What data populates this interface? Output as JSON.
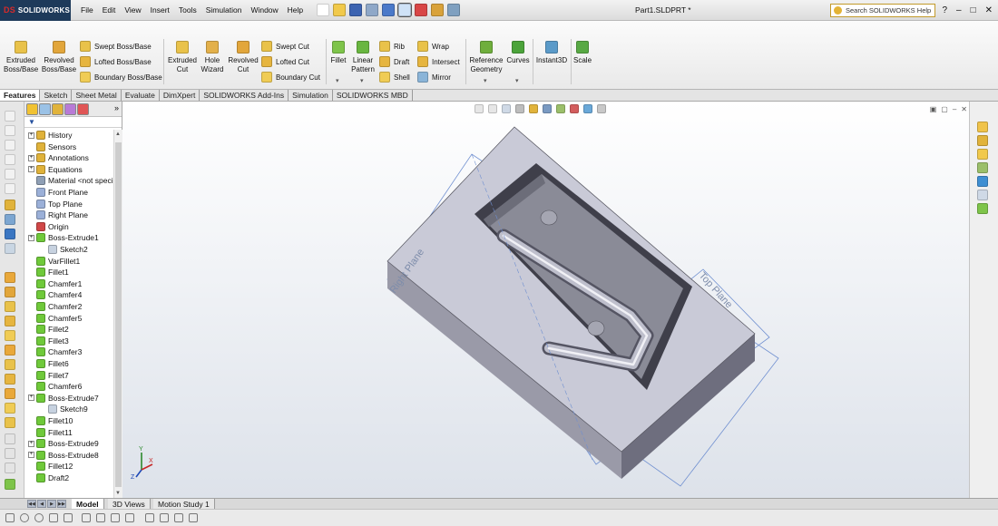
{
  "app": {
    "brand": "SOLIDWORKS",
    "brand_mark": "DS",
    "document_title": "Part1.SLDPRT *",
    "search_placeholder": "Search SOLIDWORKS Help",
    "window_controls": [
      "?",
      "–",
      "□",
      "✕"
    ]
  },
  "menu": [
    "File",
    "Edit",
    "View",
    "Insert",
    "Tools",
    "Simulation",
    "Window",
    "Help"
  ],
  "ribbon": {
    "extruded_boss": [
      "Extruded",
      "Boss/Base"
    ],
    "revolved_boss": [
      "Revolved",
      "Boss/Base"
    ],
    "swept_boss": "Swept Boss/Base",
    "lofted_boss": "Lofted Boss/Base",
    "boundary_boss": "Boundary Boss/Base",
    "extruded_cut": [
      "Extruded",
      "Cut"
    ],
    "hole_wizard": [
      "Hole",
      "Wizard"
    ],
    "revolved_cut": [
      "Revolved",
      "Cut"
    ],
    "swept_cut": "Swept Cut",
    "lofted_cut": "Lofted Cut",
    "boundary_cut": "Boundary Cut",
    "fillet": "Fillet",
    "linear_pattern": [
      "Linear",
      "Pattern"
    ],
    "rib": "Rib",
    "draft": "Draft",
    "shell": "Shell",
    "wrap": "Wrap",
    "intersect": "Intersect",
    "mirror": "Mirror",
    "reference_geometry": [
      "Reference",
      "Geometry"
    ],
    "curves": "Curves",
    "instant3d": "Instant3D",
    "scale": "Scale"
  },
  "tabs": [
    {
      "label": "Features",
      "active": true
    },
    {
      "label": "Sketch"
    },
    {
      "label": "Sheet Metal"
    },
    {
      "label": "Evaluate"
    },
    {
      "label": "DimXpert"
    },
    {
      "label": "SOLIDWORKS Add-Ins"
    },
    {
      "label": "Simulation"
    },
    {
      "label": "SOLIDWORKS MBD"
    }
  ],
  "tree": [
    {
      "label": "History",
      "indent": 0,
      "expander": true,
      "icon": "history-icon"
    },
    {
      "label": "Sensors",
      "indent": 0,
      "expander": false,
      "icon": "sensors-icon"
    },
    {
      "label": "Annotations",
      "indent": 0,
      "expander": true,
      "icon": "annotations-icon"
    },
    {
      "label": "Equations",
      "indent": 0,
      "expander": true,
      "icon": "equations-icon"
    },
    {
      "label": "Material <not speci",
      "indent": 0,
      "expander": false,
      "icon": "material-icon"
    },
    {
      "label": "Front Plane",
      "indent": 0,
      "expander": false,
      "icon": "plane-icon"
    },
    {
      "label": "Top Plane",
      "indent": 0,
      "expander": false,
      "icon": "plane-icon"
    },
    {
      "label": "Right Plane",
      "indent": 0,
      "expander": false,
      "icon": "plane-icon"
    },
    {
      "label": "Origin",
      "indent": 0,
      "expander": false,
      "icon": "origin-icon"
    },
    {
      "label": "Boss-Extrude1",
      "indent": 0,
      "expander": true,
      "icon": "feature-icon"
    },
    {
      "label": "Sketch2",
      "indent": 1,
      "expander": false,
      "icon": "sketch-icon"
    },
    {
      "label": "VarFillet1",
      "indent": 0,
      "expander": false,
      "icon": "feature-icon"
    },
    {
      "label": "Fillet1",
      "indent": 0,
      "expander": false,
      "icon": "feature-icon"
    },
    {
      "label": "Chamfer1",
      "indent": 0,
      "expander": false,
      "icon": "feature-icon"
    },
    {
      "label": "Chamfer4",
      "indent": 0,
      "expander": false,
      "icon": "feature-icon"
    },
    {
      "label": "Chamfer2",
      "indent": 0,
      "expander": false,
      "icon": "feature-icon"
    },
    {
      "label": "Chamfer5",
      "indent": 0,
      "expander": false,
      "icon": "feature-icon"
    },
    {
      "label": "Fillet2",
      "indent": 0,
      "expander": false,
      "icon": "feature-icon"
    },
    {
      "label": "Fillet3",
      "indent": 0,
      "expander": false,
      "icon": "feature-icon"
    },
    {
      "label": "Chamfer3",
      "indent": 0,
      "expander": false,
      "icon": "feature-icon"
    },
    {
      "label": "Fillet6",
      "indent": 0,
      "expander": false,
      "icon": "feature-icon"
    },
    {
      "label": "Fillet7",
      "indent": 0,
      "expander": false,
      "icon": "feature-icon"
    },
    {
      "label": "Chamfer6",
      "indent": 0,
      "expander": false,
      "icon": "feature-icon"
    },
    {
      "label": "Boss-Extrude7",
      "indent": 0,
      "expander": true,
      "icon": "feature-icon"
    },
    {
      "label": "Sketch9",
      "indent": 1,
      "expander": false,
      "icon": "sketch-icon"
    },
    {
      "label": "Fillet10",
      "indent": 0,
      "expander": false,
      "icon": "feature-icon"
    },
    {
      "label": "Fillet11",
      "indent": 0,
      "expander": false,
      "icon": "feature-icon"
    },
    {
      "label": "Boss-Extrude9",
      "indent": 0,
      "expander": true,
      "icon": "feature-icon"
    },
    {
      "label": "Boss-Extrude8",
      "indent": 0,
      "expander": true,
      "icon": "feature-icon"
    },
    {
      "label": "Fillet12",
      "indent": 0,
      "expander": false,
      "icon": "feature-icon"
    },
    {
      "label": "Draft2",
      "indent": 0,
      "expander": false,
      "icon": "feature-icon"
    }
  ],
  "viewport": {
    "plane_labels": [
      "Right Plane",
      "Top Plane"
    ],
    "triad_axes": [
      "X",
      "Y",
      "Z"
    ]
  },
  "bottom_tabs": [
    {
      "label": "Model",
      "active": true
    },
    {
      "label": "3D Views"
    },
    {
      "label": "Motion Study 1"
    }
  ],
  "colors": {
    "accent": "#1e3a5a",
    "brand_red": "#d72a2a",
    "feature_icon": "#6fc93a",
    "folder_icon": "#e0b23a",
    "plane_icon": "#9bb0d8"
  }
}
